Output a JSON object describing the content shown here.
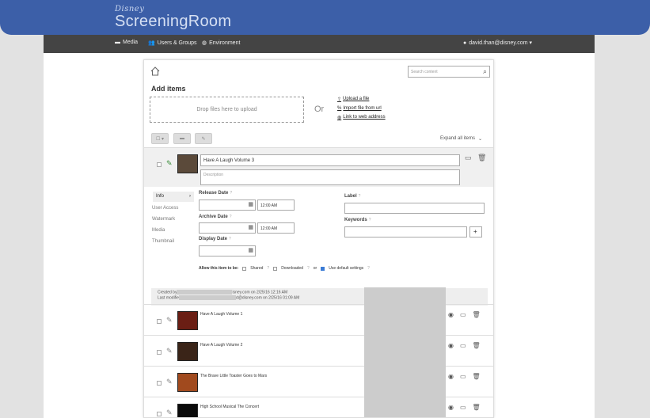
{
  "brand": {
    "small": "Disney",
    "main": "ScreeningRoom"
  },
  "nav": {
    "media": "Media",
    "users_groups": "Users & Groups",
    "environment": "Environment",
    "user": "david.than@disney.com ▾"
  },
  "search": {
    "placeholder": "Search content"
  },
  "add_items": {
    "title": "Add items",
    "dropzone": "Drop files here to upload",
    "or": "Or",
    "upload_file": "Upload a file",
    "import_url": "Import file from url",
    "link_web": "Link to web address"
  },
  "toolbar": {
    "expand_all": "Expand all items"
  },
  "editing_item": {
    "title": "Have A Laugh Volume 3",
    "description_placeholder": "Description"
  },
  "side_menu": {
    "info": "Info",
    "user_access": "User Access",
    "watermark": "Watermark",
    "media": "Media",
    "thumbnail": "Thumbnail"
  },
  "form": {
    "release_date": "Release Date",
    "archive_date": "Archive Date",
    "display_date": "Display Date",
    "time_release": "12:00 AM",
    "time_archive": "12:00 AM",
    "label": "Label",
    "keywords": "Keywords",
    "add_keyword": "+",
    "allow_text": "Allow this item to be:",
    "shared": "Shared",
    "downloaded": "Downloaded",
    "or": "or",
    "use_default": "Use default settings"
  },
  "created": {
    "line1_prefix": "Created by",
    "line1_suffix": "isney.com on 2/25/16 12:16 AM",
    "line2_prefix": "Last modifie",
    "line2_suffix": "d@disney.com on 2/25/16 01:09 AM"
  },
  "rows": [
    {
      "title": "Have A Laugh Volume 1"
    },
    {
      "title": "Have A Laugh Volume 2"
    },
    {
      "title": "The Brave Little Toaster Goes to Mars"
    },
    {
      "title": "High School Musical The Concert"
    }
  ]
}
